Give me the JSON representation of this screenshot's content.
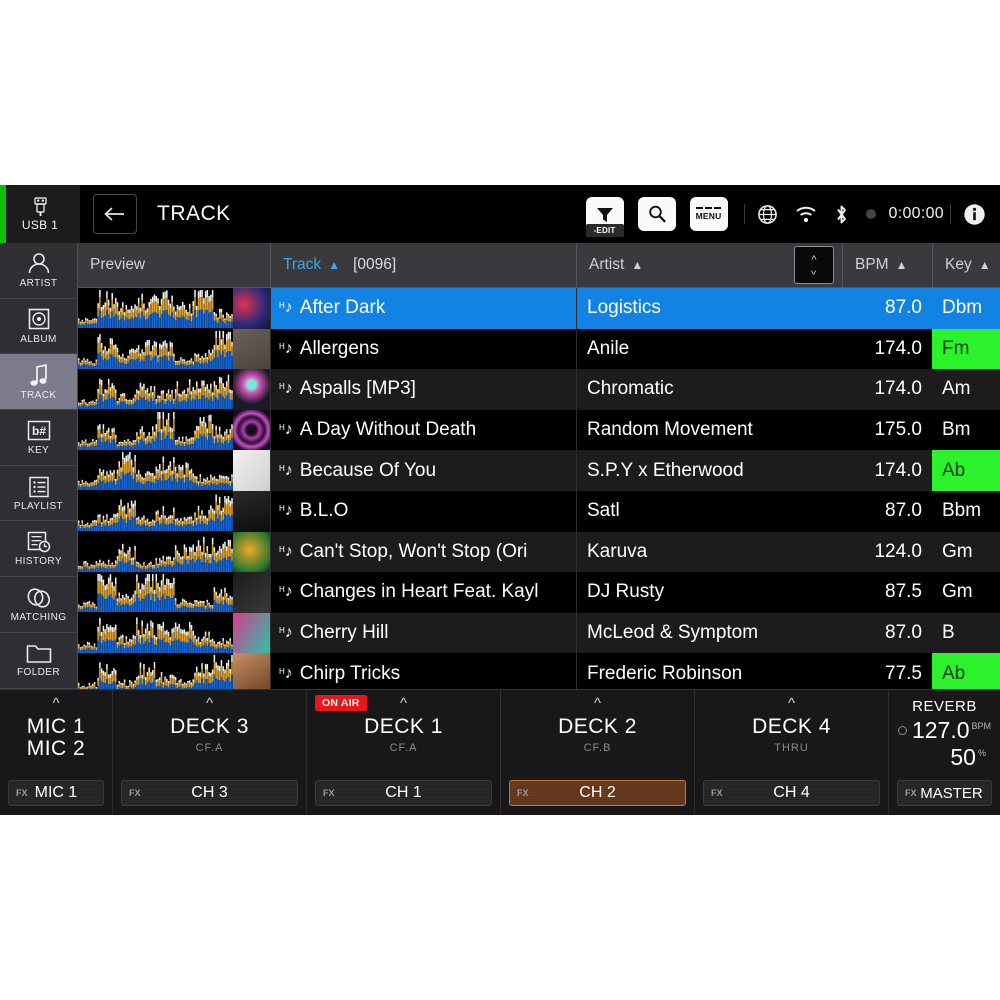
{
  "header": {
    "usb_label": "USB 1",
    "usb_icon": "usb-icon",
    "back_icon": "back-arrow-icon",
    "title": "TRACK",
    "filter_button": {
      "icon": "filter-funnel-icon",
      "label": "-EDIT"
    },
    "search_button": {
      "icon": "search-icon"
    },
    "menu_button": {
      "icon": "menu-dashes-icon",
      "label": "MENU"
    },
    "status": {
      "globe_icon": "globe-icon",
      "wifi_icon": "wifi-icon",
      "bluetooth_icon": "bluetooth-icon",
      "record_dot": "record-dot-icon",
      "timer": "0:00:00",
      "info_icon": "info-icon"
    }
  },
  "sidebar": {
    "items": [
      {
        "label": "ARTIST",
        "icon": "person-icon",
        "active": false
      },
      {
        "label": "ALBUM",
        "icon": "album-icon",
        "active": false
      },
      {
        "label": "TRACK",
        "icon": "note-icon",
        "active": true
      },
      {
        "label": "KEY",
        "icon": "key-bsharp-icon",
        "active": false
      },
      {
        "label": "PLAYLIST",
        "icon": "playlist-icon",
        "active": false
      },
      {
        "label": "HISTORY",
        "icon": "history-icon",
        "active": false
      },
      {
        "label": "MATCHING",
        "icon": "matching-icon",
        "active": false
      },
      {
        "label": "FOLDER",
        "icon": "folder-icon",
        "active": false
      }
    ]
  },
  "list": {
    "columns": {
      "preview": "Preview",
      "track": "Track",
      "track_count": "[0096]",
      "artist": "Artist",
      "bpm": "BPM",
      "key": "Key",
      "sort_arrow": "▲"
    },
    "rows": [
      {
        "title": "After Dark",
        "artist": "Logistics",
        "bpm": "87.0",
        "key": "Dbm",
        "key_highlight": false,
        "selected": true
      },
      {
        "title": "Allergens",
        "artist": "Anile",
        "bpm": "174.0",
        "key": "Fm",
        "key_highlight": true,
        "selected": false
      },
      {
        "title": "Aspalls [MP3]",
        "artist": "Chromatic",
        "bpm": "174.0",
        "key": "Am",
        "key_highlight": false,
        "selected": false
      },
      {
        "title": "A Day Without Death",
        "artist": "Random Movement",
        "bpm": "175.0",
        "key": "Bm",
        "key_highlight": false,
        "selected": false
      },
      {
        "title": "Because Of You",
        "artist": "S.P.Y x Etherwood",
        "bpm": "174.0",
        "key": "Ab",
        "key_highlight": true,
        "selected": false
      },
      {
        "title": "B.L.O",
        "artist": "Satl",
        "bpm": "87.0",
        "key": "Bbm",
        "key_highlight": false,
        "selected": false
      },
      {
        "title": "Can't Stop, Won't Stop (Ori",
        "artist": "Karuva",
        "bpm": "124.0",
        "key": "Gm",
        "key_highlight": false,
        "selected": false
      },
      {
        "title": "Changes in Heart Feat. Kayl",
        "artist": "DJ Rusty",
        "bpm": "87.5",
        "key": "Gm",
        "key_highlight": false,
        "selected": false
      },
      {
        "title": "Cherry Hill",
        "artist": "McLeod & Symptom",
        "bpm": "87.0",
        "key": "B",
        "key_highlight": false,
        "selected": false
      },
      {
        "title": "Chirp Tricks",
        "artist": "Frederic Robinson",
        "bpm": "77.5",
        "key": "Ab",
        "key_highlight": true,
        "selected": false
      }
    ]
  },
  "decks": [
    {
      "name": "MIC 1",
      "name2": "MIC 2",
      "sub": "",
      "fx_label": "FX",
      "fx_channel": "MIC 1",
      "on_air": false,
      "fx_active": false
    },
    {
      "name": "DECK 3",
      "sub": "CF.A",
      "fx_label": "FX",
      "fx_channel": "CH 3",
      "on_air": false,
      "fx_active": false
    },
    {
      "name": "DECK 1",
      "sub": "CF.A",
      "fx_label": "FX",
      "fx_channel": "CH 1",
      "on_air": true,
      "on_air_label": "ON AIR",
      "fx_active": false
    },
    {
      "name": "DECK 2",
      "sub": "CF.B",
      "fx_label": "FX",
      "fx_channel": "CH 2",
      "on_air": false,
      "fx_active": true
    },
    {
      "name": "DECK 4",
      "sub": "THRU",
      "fx_label": "FX",
      "fx_channel": "CH 4",
      "on_air": false,
      "fx_active": false
    }
  ],
  "reverb": {
    "title": "REVERB",
    "bpm_value": "127.0",
    "bpm_unit": "BPM",
    "percent_value": "50",
    "percent_unit": "%",
    "fx_label": "FX",
    "fx_target": "MASTER"
  },
  "colors": {
    "accent_blue": "#1283e4",
    "key_green": "#2bf22b",
    "on_air_red": "#e8161a",
    "usb_green": "#0bc10b",
    "fx_active_orange": "#c07a3c",
    "header_link": "#3ba7f0"
  }
}
